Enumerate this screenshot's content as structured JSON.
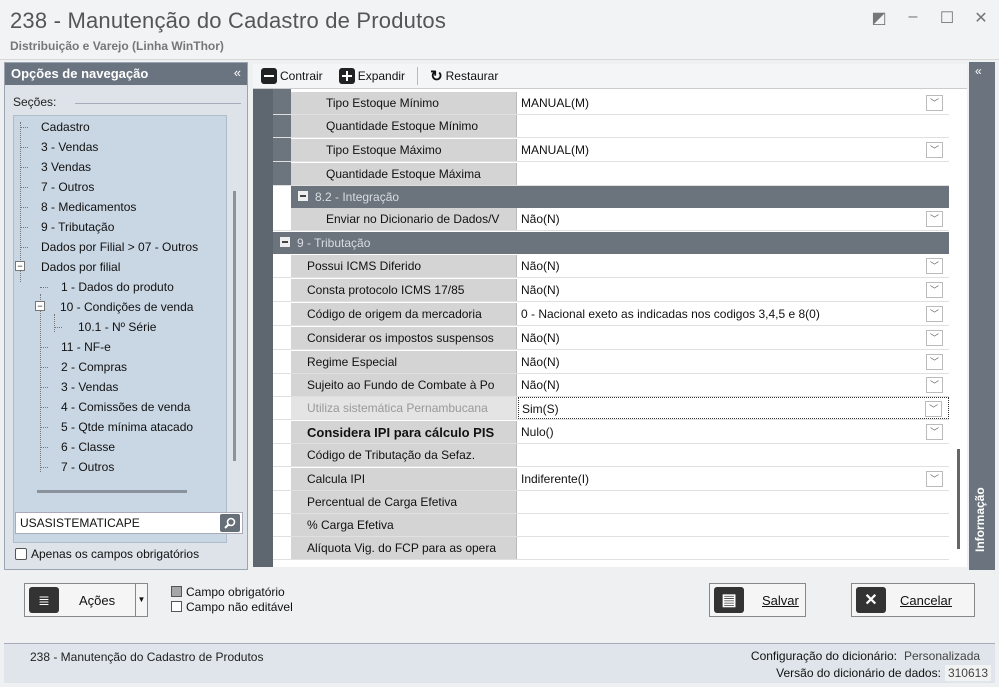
{
  "window": {
    "title": "238 - Manutenção do Cadastro de Produtos",
    "subtitle": "Distribuição e Varejo (Linha WinThor)"
  },
  "nav": {
    "header": "Opções de navegação",
    "collapse": "«",
    "sections_label": "Seções:",
    "items": [
      "Cadastro",
      "3 - Vendas",
      "3 Vendas",
      "7 - Outros",
      "8 - Medicamentos",
      "9 - Tributação",
      "Dados por Filial > 07 - Outros",
      "Dados por filial",
      "1 - Dados do produto",
      "10 - Condições de venda",
      "10.1 - Nº Série",
      "11 - NF-e",
      "2 - Compras",
      "3 - Vendas",
      "4 - Comissões de venda",
      "5 - Qtde mínima atacado",
      "6 - Classe",
      "7 - Outros"
    ],
    "search_value": "USASISTEMATICAPE",
    "required_only_label": "Apenas os campos obrigatórios"
  },
  "toolbar": {
    "collapse": "Contrair",
    "expand": "Expandir",
    "restore": "Restaurar"
  },
  "grid": {
    "rows_top": [
      {
        "label": "Tipo Estoque Mínimo",
        "value": "MANUAL(M)",
        "dropdown": true
      },
      {
        "label": "Quantidade Estoque Mínimo",
        "value": "",
        "dropdown": false
      },
      {
        "label": "Tipo Estoque Máximo",
        "value": "MANUAL(M)",
        "dropdown": true
      },
      {
        "label": "Quantidade Estoque Máxima",
        "value": "",
        "dropdown": false
      }
    ],
    "group_integration": "8.2 - Integração",
    "row_integration": {
      "label": "Enviar no Dicionario de Dados/V",
      "value": "Não(N)"
    },
    "group_tax": "9 - Tributação",
    "rows_tax": [
      {
        "label": "Possui ICMS Diferido",
        "value": "Não(N)",
        "dropdown": true
      },
      {
        "label": "Consta protocolo ICMS 17/85",
        "value": "Não(N)",
        "dropdown": true
      },
      {
        "label": "Código de origem da mercadoria",
        "value": "0 - Nacional exeto as indicadas nos codigos 3,4,5 e 8(0)",
        "dropdown": true
      },
      {
        "label": "Considerar os impostos suspensos",
        "value": "Não(N)",
        "dropdown": true
      },
      {
        "label": "Regime Especial",
        "value": "Não(N)",
        "dropdown": true
      },
      {
        "label": "Sujeito ao Fundo de Combate à Po",
        "value": "Não(N)",
        "dropdown": true
      },
      {
        "label": "Utiliza sistemática Pernambucana",
        "value": "Sim(S)",
        "dropdown": true
      },
      {
        "label": "Considera IPI para cálculo PIS",
        "value": "Nulo()",
        "dropdown": true
      },
      {
        "label": "Código de Tributação da Sefaz.",
        "value": "",
        "dropdown": false
      },
      {
        "label": "Calcula IPI",
        "value": "Indiferente(I)",
        "dropdown": true
      },
      {
        "label": "Percentual de Carga Efetiva",
        "value": "",
        "dropdown": false
      },
      {
        "label": "% Carga Efetiva",
        "value": "",
        "dropdown": false
      },
      {
        "label": "Alíquota Vig. do FCP para as opera",
        "value": "",
        "dropdown": false
      }
    ]
  },
  "infobar": {
    "label": "Informação",
    "chevron": "«"
  },
  "footer": {
    "actions": "Ações",
    "legend_required": "Campo obrigatório",
    "legend_readonly": "Campo não editável",
    "save": "Salvar",
    "cancel": "Cancelar"
  },
  "status": {
    "left": "238 - Manutenção do Cadastro de Produtos",
    "config_label": "Configuração do dicionário:",
    "config_value": "Personalizada",
    "version_label": "Versão do dicionário de dados:",
    "version_value": "310613"
  }
}
